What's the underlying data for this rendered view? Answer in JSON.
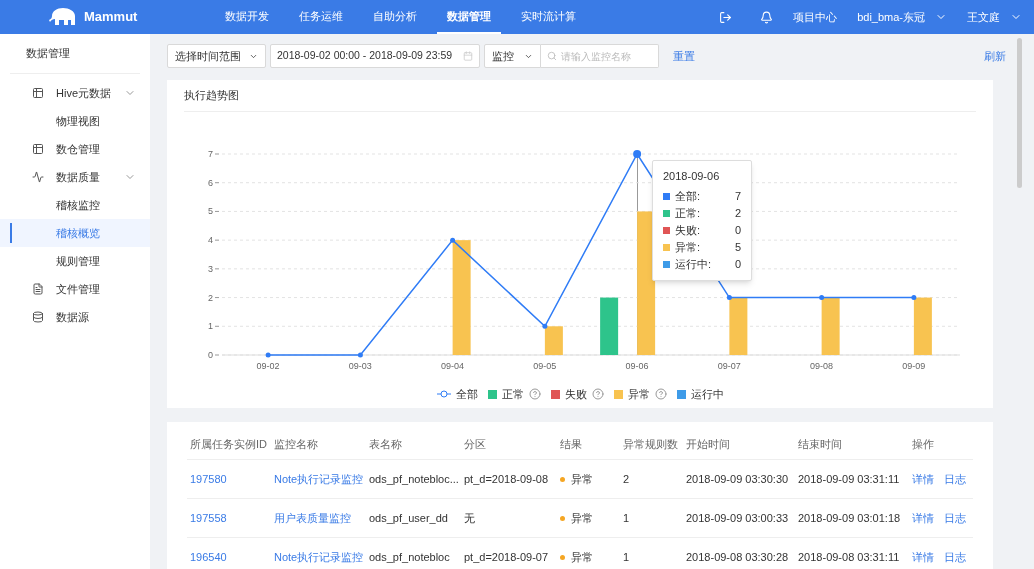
{
  "topbar": {
    "logo": "Mammut",
    "nav": [
      {
        "label": "数据开发",
        "selected": false
      },
      {
        "label": "任务运维",
        "selected": false
      },
      {
        "label": "自助分析",
        "selected": false
      },
      {
        "label": "数据管理",
        "selected": true
      },
      {
        "label": "实时流计算",
        "selected": false
      }
    ],
    "project_center": "项目中心",
    "project": "bdi_bma-东冠",
    "user": "王文庭"
  },
  "sidebar": {
    "title": "数据管理",
    "items": [
      {
        "label": "Hive元数据",
        "expanded": true,
        "selected": false,
        "children": [
          {
            "label": "物理视图",
            "selected": false
          }
        ]
      },
      {
        "label": "数仓管理",
        "selected": false
      },
      {
        "label": "数据质量",
        "expanded": true,
        "selected": false,
        "children": [
          {
            "label": "稽核监控",
            "selected": false
          },
          {
            "label": "稽核概览",
            "selected": true
          },
          {
            "label": "规则管理",
            "selected": false
          }
        ]
      },
      {
        "label": "文件管理",
        "selected": false
      },
      {
        "label": "数据源",
        "selected": false
      }
    ]
  },
  "filters": {
    "range_select": "选择时间范围",
    "date_range": "2018-09-02 00:00 - 2018-09-09 23:59",
    "type_select": "监控",
    "search": {
      "placeholder": "请输入监控名称"
    },
    "reset": "重置",
    "refresh": "刷新"
  },
  "chart": {
    "title": "执行趋势图",
    "chart_data": {
      "type": "bar",
      "categories": [
        "09-02",
        "09-03",
        "09-04",
        "09-05",
        "09-06",
        "09-07",
        "09-08",
        "09-09"
      ],
      "yticks": [
        0,
        1,
        2,
        3,
        4,
        5,
        6,
        7
      ],
      "ylim": [
        0,
        7
      ],
      "grid": true,
      "series": [
        {
          "name": "全部",
          "type": "line",
          "color": "#2f7cf6",
          "values": [
            0,
            0,
            4,
            1,
            7,
            2,
            2,
            2
          ]
        },
        {
          "name": "正常",
          "color": "#2ec48b",
          "values": [
            0,
            0,
            0,
            0,
            2,
            0,
            0,
            0
          ]
        },
        {
          "name": "失败",
          "color": "#e05555",
          "values": [
            0,
            0,
            0,
            0,
            0,
            0,
            0,
            0
          ]
        },
        {
          "name": "异常",
          "color": "#f8c350",
          "values": [
            0,
            0,
            4,
            1,
            5,
            2,
            2,
            2
          ]
        },
        {
          "name": "运行中",
          "color": "#3e9be8",
          "values": [
            0,
            0,
            0,
            0,
            0,
            0,
            0,
            0
          ]
        }
      ]
    },
    "legend": [
      {
        "help": false
      },
      {
        "help": true
      },
      {
        "help": true
      },
      {
        "help": true
      },
      {
        "help": false
      }
    ],
    "tooltip": {
      "title": "2018-09-06",
      "rows": [
        {
          "label": "全部:",
          "value": "7"
        },
        {
          "label": "正常:",
          "value": "2"
        },
        {
          "label": "失败:",
          "value": "0"
        },
        {
          "label": "异常:",
          "value": "5"
        },
        {
          "label": "运行中:",
          "value": "0"
        }
      ]
    }
  },
  "table": {
    "columns": [
      "所属任务实例ID",
      "监控名称",
      "表名称",
      "分区",
      "结果",
      "异常规则数",
      "开始时间",
      "结束时间",
      "操作"
    ],
    "rows": [
      {
        "id": "197580",
        "monitor": "Note执行记录监控",
        "table": "ods_pf_notebloc...",
        "partition": "pt_d=2018-09-08",
        "result": "异常",
        "count": "2",
        "start": "2018-09-09 03:30:30",
        "end": "2018-09-09 03:31:11",
        "actions": [
          "详情",
          "日志"
        ]
      },
      {
        "id": "197558",
        "monitor": "用户表质量监控",
        "table": "ods_pf_user_dd",
        "partition": "无",
        "result": "异常",
        "count": "1",
        "start": "2018-09-09 03:00:33",
        "end": "2018-09-09 03:01:18",
        "actions": [
          "详情",
          "日志"
        ]
      },
      {
        "id": "196540",
        "monitor": "Note执行记录监控",
        "table": "ods_pf_notebloc",
        "partition": "pt_d=2018-09-07",
        "result": "异常",
        "count": "1",
        "start": "2018-09-08 03:30:28",
        "end": "2018-09-08 03:31:11",
        "actions": [
          "详情",
          "日志"
        ]
      }
    ]
  }
}
